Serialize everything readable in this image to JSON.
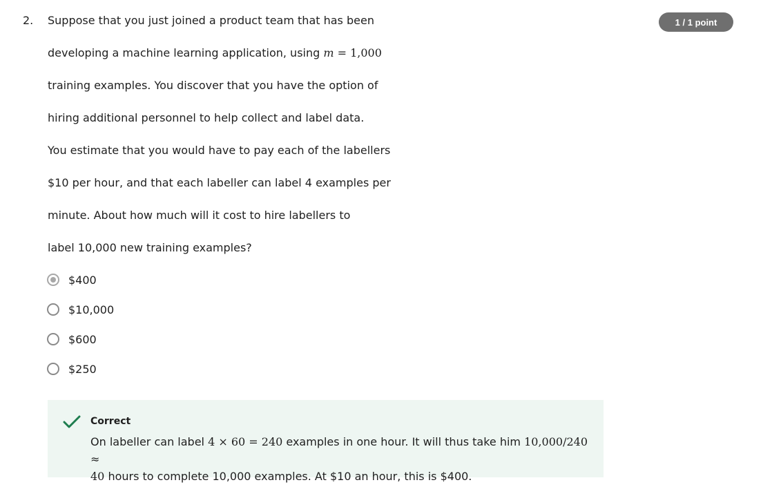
{
  "question": {
    "number": "2.",
    "score_badge": "1 / 1 point",
    "lines": {
      "l1": "Suppose that you just joined a product team that has been",
      "l2_pre": "developing a machine learning application, using ",
      "l2_math_var": "m",
      "l2_math_rest": " = 1,000",
      "l3": "training examples. You discover that you have the option of",
      "l4": "hiring additional personnel to help collect and label data.",
      "l5": "You estimate that you would have to pay each of the labellers",
      "l6": "$10 per hour, and that each labeller can label 4 examples per",
      "l7": "minute. About how much will it cost to hire labellers to",
      "l8": "label 10,000 new training examples?"
    }
  },
  "options": [
    {
      "label": "$400",
      "selected": true
    },
    {
      "label": "$10,000",
      "selected": false
    },
    {
      "label": "$600",
      "selected": false
    },
    {
      "label": "$250",
      "selected": false
    }
  ],
  "feedback": {
    "status": "Correct",
    "status_color": "#1e7d4f",
    "text_a": "On labeller can label ",
    "math_a": "4 × 60 = 240",
    "text_b": " examples in one hour. It will thus take him ",
    "math_b": "10,000/240 ≈",
    "math_c": "40",
    "text_c": " hours to complete 10,000 examples. At $10 an hour, this is $400."
  }
}
